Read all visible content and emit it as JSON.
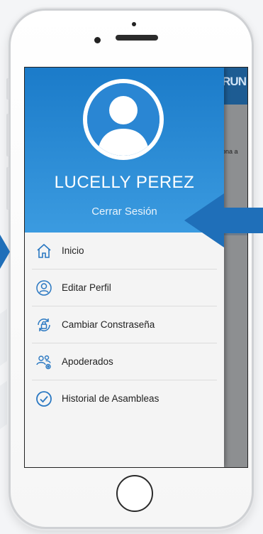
{
  "profile": {
    "name": "LUCELLY PEREZ",
    "logout_label": "Cerrar Sesión"
  },
  "menu": {
    "items": [
      {
        "label": "Inicio",
        "icon": "home-icon"
      },
      {
        "label": "Editar Perfil",
        "icon": "user-circle-icon"
      },
      {
        "label": "Cambiar Constraseña",
        "icon": "lock-refresh-icon"
      },
      {
        "label": "Apoderados",
        "icon": "users-icon"
      },
      {
        "label": "Historial de Asambleas",
        "icon": "check-circle-icon"
      }
    ]
  },
  "background_app": {
    "logo_fragment": "RUN",
    "text_fragment": "iona a"
  },
  "colors": {
    "accent": "#1b7bc9",
    "icon": "#2a78c2",
    "arrow": "#1f6fb9"
  }
}
